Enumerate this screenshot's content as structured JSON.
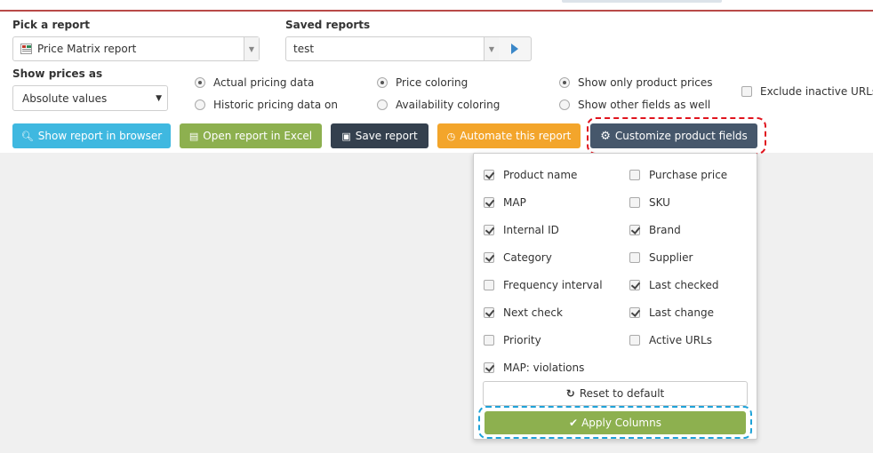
{
  "pick_report": {
    "label": "Pick a report",
    "selected": "Price Matrix report"
  },
  "saved_reports": {
    "label": "Saved reports",
    "selected": "test"
  },
  "show_prices": {
    "label": "Show prices as",
    "selected": "Absolute values"
  },
  "data_source": {
    "options": [
      {
        "label": "Actual pricing data",
        "checked": true
      },
      {
        "label": "Historic pricing data on",
        "checked": false
      }
    ]
  },
  "coloring": {
    "options": [
      {
        "label": "Price coloring",
        "checked": true
      },
      {
        "label": "Availability coloring",
        "checked": false
      }
    ]
  },
  "fields_mode": {
    "options": [
      {
        "label": "Show only product prices",
        "checked": true
      },
      {
        "label": "Show other fields as well",
        "checked": false
      }
    ]
  },
  "exclude_inactive": {
    "label": "Exclude inactive URLs",
    "checked": false
  },
  "buttons": {
    "show_browser": "Show report in browser",
    "open_excel": "Open report in Excel",
    "save_report": "Save report",
    "automate": "Automate this report",
    "customize": "Customize product fields"
  },
  "colors": {
    "blue": "#3fb8e0",
    "green": "#8db04f",
    "dark": "#34404e",
    "orange": "#f3a52b",
    "customize": "#46576b",
    "highlight_red": "#e0141e",
    "highlight_blue": "#1ea2d8"
  },
  "fields": {
    "left": [
      {
        "label": "Product name",
        "checked": true
      },
      {
        "label": "MAP",
        "checked": true
      },
      {
        "label": "Internal ID",
        "checked": true
      },
      {
        "label": "Category",
        "checked": true
      },
      {
        "label": "Frequency interval",
        "checked": false
      },
      {
        "label": "Next check",
        "checked": true
      },
      {
        "label": "Priority",
        "checked": false
      },
      {
        "label": "MAP: violations",
        "checked": true
      }
    ],
    "right": [
      {
        "label": "Purchase price",
        "checked": false
      },
      {
        "label": "SKU",
        "checked": false
      },
      {
        "label": "Brand",
        "checked": true
      },
      {
        "label": "Supplier",
        "checked": false
      },
      {
        "label": "Last checked",
        "checked": true
      },
      {
        "label": "Last change",
        "checked": true
      },
      {
        "label": "Active URLs",
        "checked": false
      }
    ],
    "reset_label": "Reset to default",
    "apply_label": "Apply Columns"
  }
}
